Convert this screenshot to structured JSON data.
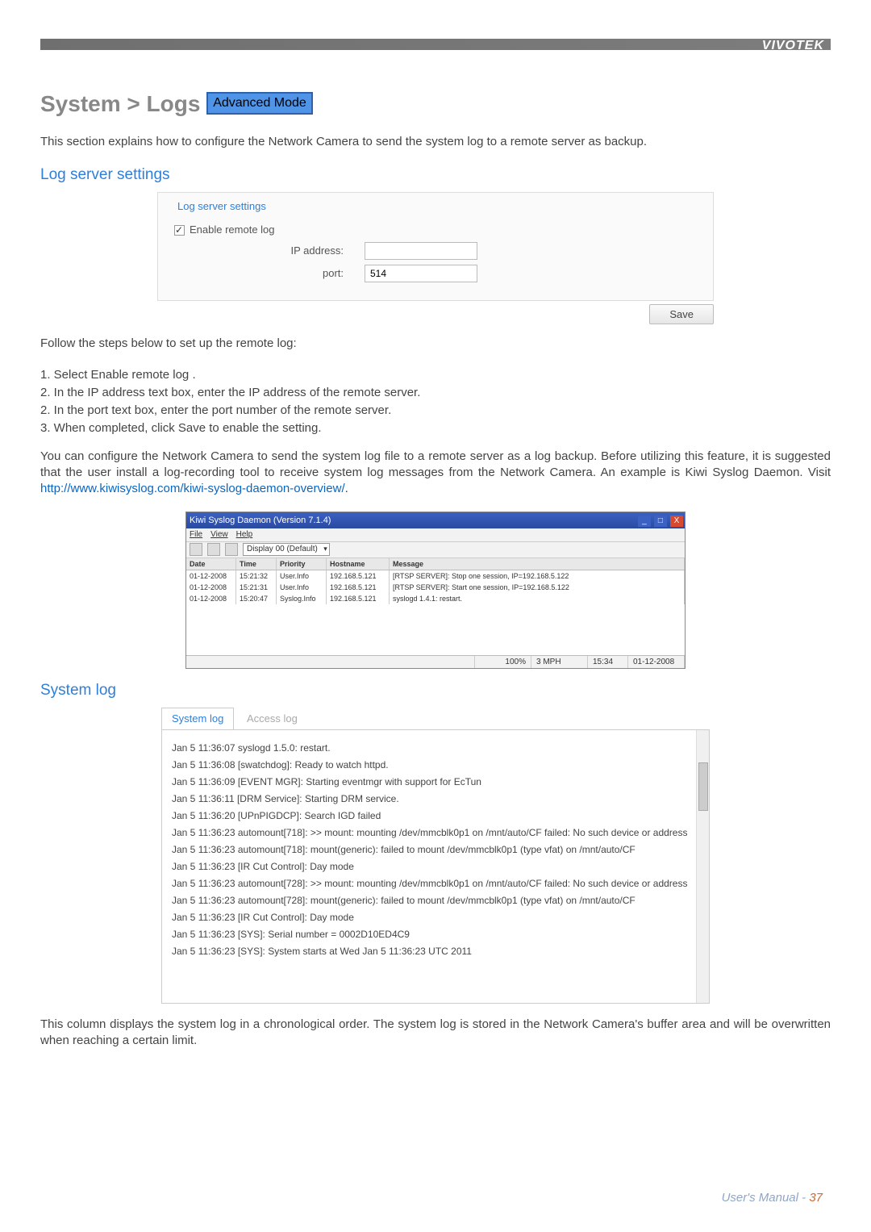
{
  "brand": "VIVOTEK",
  "heading": {
    "crumb": "System > Logs",
    "badge": "Advanced Mode"
  },
  "intro": "This section explains how to configure the Network Camera to send the system log to a remote server as backup.",
  "h2_logserver": "Log server settings",
  "panel": {
    "title": "Log server settings",
    "enable_label": "Enable remote log",
    "ip_label": "IP address:",
    "ip_value": "",
    "port_label": "port:",
    "port_value": "514",
    "save_label": "Save"
  },
  "follow": "Follow the steps below to set up the remote log:",
  "steps": [
    "1. Select Enable remote log  .",
    "2. In the IP address text box, enter the IP address of the remote server.",
    "2. In the port text box, enter the port number of the remote server.",
    "3. When completed, click Save to enable the setting."
  ],
  "para2_a": "You can configure the Network Camera to send the system log file to a remote server as a log backup. Before utilizing this feature, it is suggested that the user install a log-recording tool to receive system log messages from the Network Camera. An example is Kiwi Syslog Daemon. Visit ",
  "para2_link": "http://www.kiwisyslog.com/kiwi-syslog-daemon-overview/",
  "para2_b": ".",
  "kiwi": {
    "title": "Kiwi Syslog Daemon (Version 7.1.4)",
    "menu": [
      "File",
      "View",
      "Help"
    ],
    "display": "Display 00 (Default)",
    "headers": {
      "date": "Date",
      "time": "Time",
      "priority": "Priority",
      "hostname": "Hostname",
      "message": "Message"
    },
    "rows": [
      {
        "date": "01-12-2008",
        "time": "15:21:32",
        "priority": "User.Info",
        "hostname": "192.168.5.121",
        "message": "[RTSP SERVER]: Stop one session, IP=192.168.5.122"
      },
      {
        "date": "01-12-2008",
        "time": "15:21:31",
        "priority": "User.Info",
        "hostname": "192.168.5.121",
        "message": "[RTSP SERVER]: Start one session, IP=192.168.5.122"
      },
      {
        "date": "01-12-2008",
        "time": "15:20:47",
        "priority": "Syslog.Info",
        "hostname": "192.168.5.121",
        "message": "syslogd 1.4.1: restart."
      }
    ],
    "status": {
      "pct": "100%",
      "mph": "3 MPH",
      "time": "15:34",
      "date": "01-12-2008"
    }
  },
  "h2_syslog": "System log",
  "tabs": {
    "active": "System log",
    "inactive": "Access log"
  },
  "loglines": [
    "Jan 5 11:36:07 syslogd 1.5.0: restart.",
    "Jan 5 11:36:08 [swatchdog]: Ready to watch httpd.",
    "Jan 5 11:36:09 [EVENT MGR]: Starting eventmgr with support for EcTun",
    "Jan 5 11:36:11 [DRM Service]: Starting DRM service.",
    "Jan 5 11:36:20 [UPnPIGDCP]: Search IGD failed",
    "Jan 5 11:36:23 automount[718]: >> mount: mounting /dev/mmcblk0p1 on /mnt/auto/CF failed: No such device or address",
    "Jan 5 11:36:23 automount[718]: mount(generic): failed to mount /dev/mmcblk0p1 (type vfat) on /mnt/auto/CF",
    "Jan 5 11:36:23 [IR Cut Control]: Day mode",
    "Jan 5 11:36:23 automount[728]: >> mount: mounting /dev/mmcblk0p1 on /mnt/auto/CF failed: No such device or address",
    "Jan 5 11:36:23 automount[728]: mount(generic): failed to mount /dev/mmcblk0p1 (type vfat) on /mnt/auto/CF",
    "Jan 5 11:36:23 [IR Cut Control]: Day mode",
    "Jan 5 11:36:23 [SYS]: Serial number = 0002D10ED4C9",
    "Jan 5 11:36:23 [SYS]: System starts at Wed Jan 5 11:36:23 UTC 2011"
  ],
  "closing": "This column displays the system log in a chronological order. The system log is stored in the Network Camera's buffer area and will be overwritten when reaching a certain limit.",
  "footer": {
    "um": "User's Manual - ",
    "pg": "37"
  }
}
